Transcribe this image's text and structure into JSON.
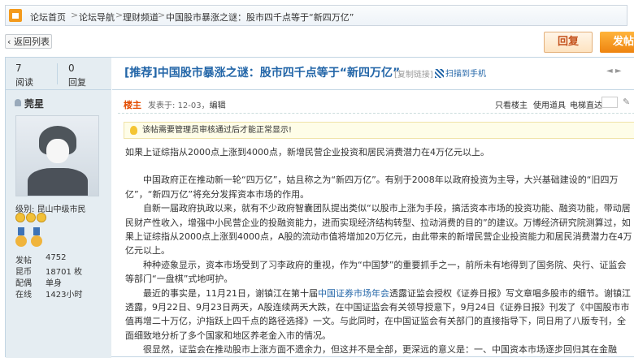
{
  "breadcrumb": {
    "items": [
      "论坛首页",
      "论坛导航",
      "理财频道",
      "中国股市暴涨之谜：股市四千点等于“新四万亿”"
    ],
    "separator": ">"
  },
  "toolbar": {
    "back_label": "‹ 返回列表",
    "reply_label": "回复",
    "post_label": "发帖"
  },
  "thread": {
    "views": "7",
    "views_label": "阅读",
    "replies": "0",
    "replies_label": "回复",
    "title": "[推荐]中国股市暴涨之谜：股市四千点等于“新四万亿”",
    "copy_link": "[复制链接]",
    "qr_label": "扫描到手机",
    "nav_arrows": "◄ ►"
  },
  "user": {
    "name": "莞星",
    "level_prefix": "级别: ",
    "level": "昆山中级市民",
    "stats": [
      {
        "key": "发帖",
        "value": "4752"
      },
      {
        "key": "昆币",
        "value": "18701 枚"
      },
      {
        "key": "配偶",
        "value": "单身"
      },
      {
        "key": "在线",
        "value": "1423小时"
      }
    ]
  },
  "post": {
    "author_badge": "楼主",
    "posted_prefix": "发表于: ",
    "posted_date": "12-03",
    "edit_label": "编辑",
    "view_only_author": "只看楼主",
    "use_props": "使用道具",
    "elevator_label": "电梯直达",
    "notice": "该帖需要管理员审核通过后才能正常显示!",
    "lead": "如果上证综指从2000点上涨到4000点，新增民营企业投资和居民消费潜力在4万亿元以上。",
    "paragraphs": [
      "中国政府正在推动新一轮“四万亿”，姑且称之为“新四万亿”。有别于2008年以政府投资为主导，大兴基础建设的“旧四万亿”，“新四万亿”将充分发挥资本市场的作用。",
      "自新一届政府执政以来，就有不少政府智囊团队提出类似“以股市上涨为手段，搞活资本市场的投资功能、融资功能，带动居民财产性收入，增强中小民营企业的投融资能力，进而实现经济结构转型、拉动消费的目的”的建议。万博经济研究院测算过，如果上证综指从2000点上涨到4000点，A股的流动市值将增加20万亿元，由此带来的新增民营企业投资能力和居民消费潜力在4万亿元以上。",
      "种种迹象显示，资本市场受到了习李政府的重视，作为“中国梦”的重要抓手之一，前所未有地得到了国务院、央行、证监会等部门“一盘棋”式地呵护。"
    ],
    "para4_a": "最近的事实是，11月21日，谢镇江在第十届",
    "para4_link": "中国证券市场年会",
    "para4_b": "透露证监会授权《证券日报》写文章唱多股市的细节。谢镇江透露，9月22日、9月23日两天，A股连续两天大跌，在中国证监会有关领导授意下，9月24日《证券日报》刊发了《中国股市市值再增二十万亿，沪指跃上四千点的路径选择》一文。与此同时，在中国证监会有关部门的直接指导下，同日用了八版专刊，全面细致地分析了多个国家和地区养老金入市的情况。",
    "para5": "很显然，证监会在推动股市上涨方面不遗余力，但这并不是全部，更深远的意义是：一、中国资本市场逐步回归其在金融"
  }
}
